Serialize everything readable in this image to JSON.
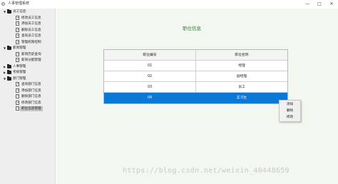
{
  "window": {
    "title": "人事管理系统",
    "controls": {
      "minimize": "—",
      "maximize": "□",
      "close": "✕"
    }
  },
  "sidebar": {
    "nodes": [
      {
        "label": "员工信息",
        "level": 0,
        "kind": "folder",
        "arrow": "▼",
        "icon": "folder-icon"
      },
      {
        "label": "修改员工信息",
        "level": 1,
        "kind": "doc",
        "icon": "document-icon"
      },
      {
        "label": "添加员工信息",
        "level": 1,
        "kind": "doc",
        "icon": "document-icon"
      },
      {
        "label": "删除员工信息",
        "level": 1,
        "kind": "doc",
        "icon": "document-icon"
      },
      {
        "label": "查询员工信息",
        "level": 1,
        "kind": "doc",
        "icon": "document-icon"
      },
      {
        "label": "管理权限控制",
        "level": 1,
        "kind": "doc",
        "icon": "document-icon"
      },
      {
        "label": "薪资管理",
        "level": 0,
        "kind": "folder",
        "arrow": "▼",
        "icon": "folder-icon"
      },
      {
        "label": "薪资历史查询",
        "level": 1,
        "kind": "doc",
        "icon": "document-icon"
      },
      {
        "label": "薪资分配管理",
        "level": 1,
        "kind": "doc",
        "icon": "document-icon"
      },
      {
        "label": "人事管理",
        "level": 0,
        "kind": "folder",
        "arrow": "▶",
        "icon": "folder-icon"
      },
      {
        "label": "考核管理",
        "level": 0,
        "kind": "folder",
        "arrow": "▶",
        "icon": "folder-icon"
      },
      {
        "label": "部门管理",
        "level": 0,
        "kind": "folder",
        "arrow": "▼",
        "icon": "folder-icon"
      },
      {
        "label": "查询部门信息",
        "level": 1,
        "kind": "doc",
        "icon": "document-icon"
      },
      {
        "label": "添加部门信息",
        "level": 1,
        "kind": "doc",
        "icon": "document-icon"
      },
      {
        "label": "删除部门信息",
        "level": 1,
        "kind": "doc",
        "icon": "document-icon"
      },
      {
        "label": "修改部门信息",
        "level": 1,
        "kind": "doc",
        "icon": "document-icon"
      },
      {
        "label": "职位信息管理",
        "level": 1,
        "kind": "doc",
        "icon": "document-icon",
        "selected": true
      }
    ]
  },
  "main": {
    "title": "职位信息",
    "table": {
      "columns": [
        "职位编号",
        "职位名称"
      ],
      "rows": [
        [
          "01",
          "经理"
        ],
        [
          "02",
          "副经理"
        ],
        [
          "03",
          "员工"
        ],
        [
          "04",
          "实习生"
        ]
      ],
      "selected_row": 3
    },
    "context_menu": [
      "添加",
      "删除",
      "修改"
    ]
  },
  "watermark": "https://blog.csdn.net/weixin_40448659",
  "colors": {
    "selection": "#0a78d7",
    "content_bg": "#f2f8ef",
    "title_green": "#2e7a3d",
    "sidebar_bg": "#eeeeee"
  }
}
